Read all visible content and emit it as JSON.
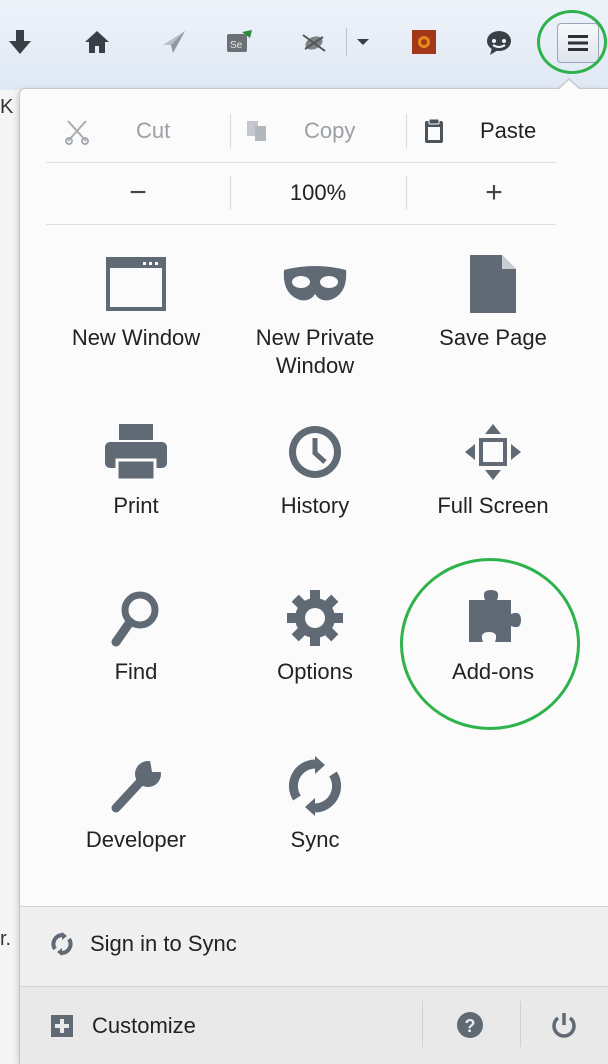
{
  "page_fragments": {
    "top_left": "K",
    "bottom_left": "r."
  },
  "toolbar": {
    "buttons": [
      {
        "id": "downloads",
        "icon": "download-arrow-icon"
      },
      {
        "id": "home",
        "icon": "home-icon"
      },
      {
        "id": "send",
        "icon": "paper-plane-icon"
      },
      {
        "id": "selenium",
        "icon": "selenium-ide-icon"
      },
      {
        "id": "firebug",
        "icon": "bug-icon"
      },
      {
        "id": "dropdown",
        "icon": "dropdown-caret-icon"
      },
      {
        "id": "extension",
        "icon": "orange-extension-icon"
      },
      {
        "id": "chat",
        "icon": "speech-bubble-icon"
      },
      {
        "id": "menu",
        "icon": "hamburger-menu-icon"
      }
    ]
  },
  "menu": {
    "edit": {
      "cut": "Cut",
      "copy": "Copy",
      "paste": "Paste"
    },
    "zoom": {
      "minus": "−",
      "level": "100%",
      "plus": "+"
    },
    "items": {
      "new_window": "New Window",
      "new_private_window": "New Private Window",
      "save_page": "Save Page",
      "print": "Print",
      "history": "History",
      "full_screen": "Full Screen",
      "find": "Find",
      "options": "Options",
      "addons": "Add-ons",
      "developer": "Developer",
      "sync": "Sync"
    },
    "footer": {
      "sign_in": "Sign in to Sync",
      "customize": "Customize"
    }
  },
  "colors": {
    "highlight_ring": "#2eb24b",
    "icon_gray": "#5f6a75",
    "panel_bg": "#fbfbfb"
  }
}
